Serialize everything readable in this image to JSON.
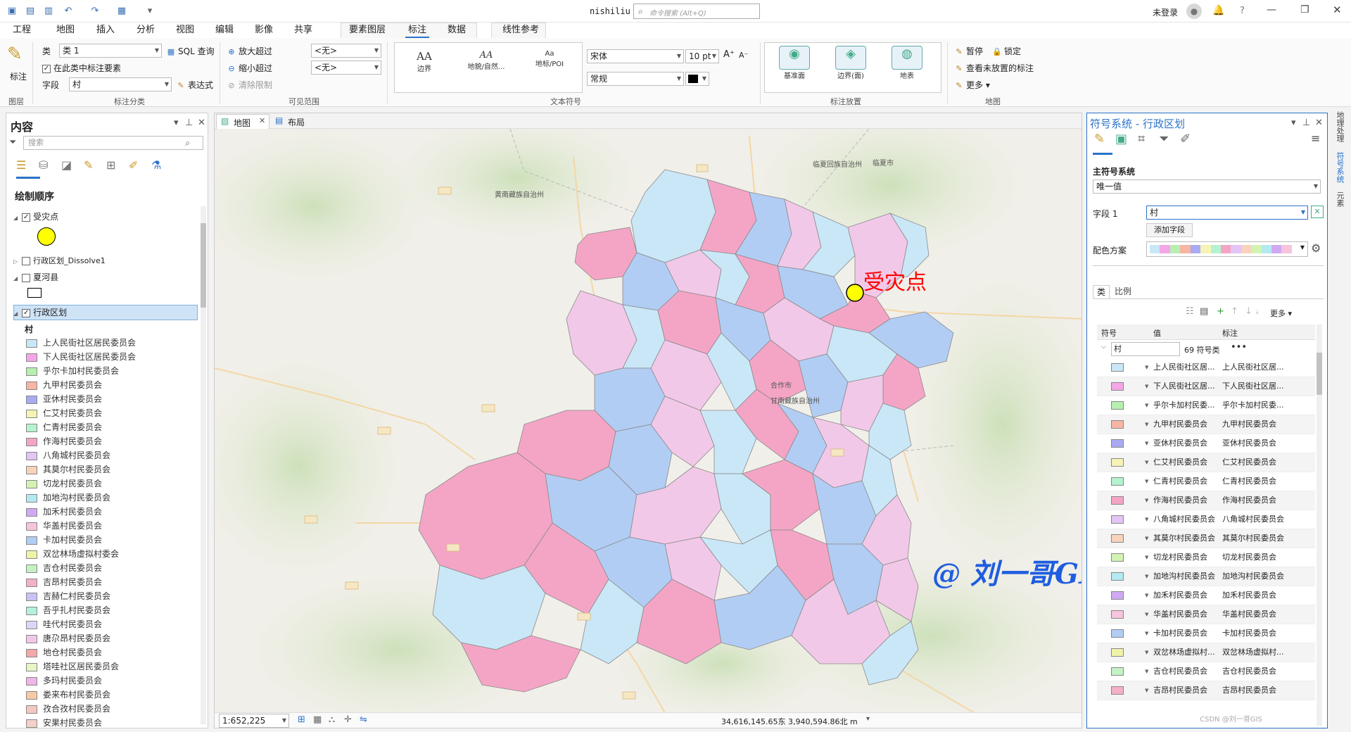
{
  "titlebar": {
    "doc_name": "nishiliu",
    "search_placeholder": "命令搜索 (Alt+Q)",
    "user": "未登录",
    "help": "?"
  },
  "menu_tabs": [
    "工程",
    "地图",
    "插入",
    "分析",
    "视图",
    "编辑",
    "影像",
    "共享",
    "要素图层",
    "标注",
    "数据",
    "线性参考"
  ],
  "ribbon": {
    "label_btn": "标注",
    "class_label": "类",
    "class_value": "类 1",
    "sql_query": "SQL 查询",
    "label_features_check": "在此类中标注要素",
    "field_label": "字段",
    "field_value": "村",
    "expression": "表达式",
    "group_label_class": "标注分类",
    "group_layer": "图层",
    "zoom_in_beyond": "放大超过",
    "zoom_out_beyond": "缩小超过",
    "clear_limits": "清除限制",
    "none1": "<无>",
    "none2": "<无>",
    "group_visible_range": "可见范围",
    "text_symbol_items": [
      {
        "glyph": "AA",
        "label": "边界"
      },
      {
        "glyph": "AA",
        "label": "地貌/自然..."
      },
      {
        "glyph": "Aa",
        "label": "地标/POI"
      }
    ],
    "font_name": "宋体",
    "font_size": "10 pt",
    "font_style": "常规",
    "group_text_symbol": "文本符号",
    "placement_items": [
      {
        "label": "基准面"
      },
      {
        "label": "边界(面)"
      },
      {
        "label": "地表"
      }
    ],
    "group_label_placement": "标注放置",
    "pause": "暂停",
    "lock": "锁定",
    "view_unplaced": "查看未放置的标注",
    "more": "更多",
    "group_map": "地图"
  },
  "contents": {
    "title": "内容",
    "search_placeholder": "搜索",
    "drawing_order": "绘制顺序",
    "layers": [
      {
        "name": "受灾点",
        "checked": true
      },
      {
        "name": "行政区划_Dissolve1",
        "checked": false
      },
      {
        "name": "夏河县",
        "checked": false
      },
      {
        "name": "行政区划",
        "checked": true
      }
    ],
    "field_heading": "村",
    "legend": [
      {
        "label": "上人民街社区居民委员会",
        "color": "#c9e7f7"
      },
      {
        "label": "下人民街社区居民委员会",
        "color": "#f4a6e6"
      },
      {
        "label": "乎尔卡加村民委员会",
        "color": "#b6efb0"
      },
      {
        "label": "九甲村民委员会",
        "color": "#f7b5a4"
      },
      {
        "label": "亚休村民委员会",
        "color": "#a9aaf2"
      },
      {
        "label": "仁艾村民委员会",
        "color": "#f6f4b4"
      },
      {
        "label": "仁青村民委员会",
        "color": "#b4f2d0"
      },
      {
        "label": "作海村民委员会",
        "color": "#f4a5c5"
      },
      {
        "label": "八角城村民委员会",
        "color": "#e2c4f5"
      },
      {
        "label": "其莫尔村民委员会",
        "color": "#f8d2ba"
      },
      {
        "label": "切龙村民委员会",
        "color": "#d2f3b2"
      },
      {
        "label": "加地沟村民委员会",
        "color": "#b4e9f1"
      },
      {
        "label": "加禾村民委员会",
        "color": "#cfaaf2"
      },
      {
        "label": "华盖村民委员会",
        "color": "#f6c4dd"
      },
      {
        "label": "卡加村民委员会",
        "color": "#b2cdf4"
      },
      {
        "label": "双岔林场虚拟村委会",
        "color": "#eef3a8"
      },
      {
        "label": "吉仓村民委员会",
        "color": "#c4f2c4"
      },
      {
        "label": "吉昂村民委员会",
        "color": "#f4b0c8"
      },
      {
        "label": "吉赫仁村民委员会",
        "color": "#c8c2f4"
      },
      {
        "label": "吾乎扎村民委员会",
        "color": "#b4f0dc"
      },
      {
        "label": "哇代村民委员会",
        "color": "#d8d8f6"
      },
      {
        "label": "唐尕昂村民委员会",
        "color": "#f2c8e8"
      },
      {
        "label": "地仓村民委员会",
        "color": "#f5a8a8"
      },
      {
        "label": "塔哇社区居民委员会",
        "color": "#e8f5c4"
      },
      {
        "label": "多玛村民委员会",
        "color": "#f0b6e8"
      },
      {
        "label": "娄来布村民委员会",
        "color": "#f6caa4"
      },
      {
        "label": "孜合孜村民委员会",
        "color": "#f4c8c0"
      },
      {
        "label": "安果村民委员会",
        "color": "#f3d0c8"
      }
    ]
  },
  "map": {
    "tab_map": "地图",
    "tab_layout": "布局",
    "annotation": "受灾点",
    "scale": "1:652,225",
    "coords": "34,616,145.65东  3,940,594.86北 m",
    "place_labels": [
      {
        "text": "黄南藏族自治州"
      },
      {
        "text": "临夏回族自治州"
      },
      {
        "text": "临夏市"
      },
      {
        "text": "合作市"
      },
      {
        "text": "甘南藏族自治州"
      }
    ]
  },
  "symbology": {
    "title": "符号系统 - 行政区划",
    "primary": "主符号系统",
    "method": "唯一值",
    "field1_label": "字段 1",
    "field1_value": "村",
    "add_field": "添加字段",
    "color_scheme_label": "配色方案",
    "tab_classes": "类",
    "tab_scale": "比例",
    "more": "更多",
    "col_symbol": "符号",
    "col_value": "值",
    "col_label": "标注",
    "group_value": "村",
    "group_count": "69 符号类",
    "rows": [
      {
        "value": "上人民街社区居...",
        "label": "上人民街社区居...",
        "color": "#c9e7f7"
      },
      {
        "value": "下人民街社区居...",
        "label": "下人民街社区居...",
        "color": "#f4a6e6"
      },
      {
        "value": "乎尔卡加村民委...",
        "label": "乎尔卡加村民委...",
        "color": "#b6efb0"
      },
      {
        "value": "九甲村民委员会",
        "label": "九甲村民委员会",
        "color": "#f7b5a4"
      },
      {
        "value": "亚休村民委员会",
        "label": "亚休村民委员会",
        "color": "#a9aaf2"
      },
      {
        "value": "仁艾村民委员会",
        "label": "仁艾村民委员会",
        "color": "#f6f4b4"
      },
      {
        "value": "仁青村民委员会",
        "label": "仁青村民委员会",
        "color": "#b4f2d0"
      },
      {
        "value": "作海村民委员会",
        "label": "作海村民委员会",
        "color": "#f4a5c5"
      },
      {
        "value": "八角城村民委员会",
        "label": "八角城村民委员会",
        "color": "#e2c4f5"
      },
      {
        "value": "其莫尔村民委员会",
        "label": "其莫尔村民委员会",
        "color": "#f8d2ba"
      },
      {
        "value": "切龙村民委员会",
        "label": "切龙村民委员会",
        "color": "#d2f3b2"
      },
      {
        "value": "加地沟村民委员会",
        "label": "加地沟村民委员会",
        "color": "#b4e9f1"
      },
      {
        "value": "加禾村民委员会",
        "label": "加禾村民委员会",
        "color": "#cfaaf2"
      },
      {
        "value": "华盖村民委员会",
        "label": "华盖村民委员会",
        "color": "#f6c4dd"
      },
      {
        "value": "卡加村民委员会",
        "label": "卡加村民委员会",
        "color": "#b2cdf4"
      },
      {
        "value": "双岔林场虚拟村...",
        "label": "双岔林场虚拟村...",
        "color": "#eef3a8"
      },
      {
        "value": "吉仓村民委员会",
        "label": "吉仓村民委员会",
        "color": "#c4f2c4"
      },
      {
        "value": "吉昂村民委员会",
        "label": "吉昂村民委员会",
        "color": "#f4b0c8"
      }
    ]
  },
  "right_strip": [
    "地理处理",
    "符号系统",
    "元素"
  ],
  "watermark": "@ 刘一哥GIS",
  "csdn": "CSDN @刘一哥GIS"
}
